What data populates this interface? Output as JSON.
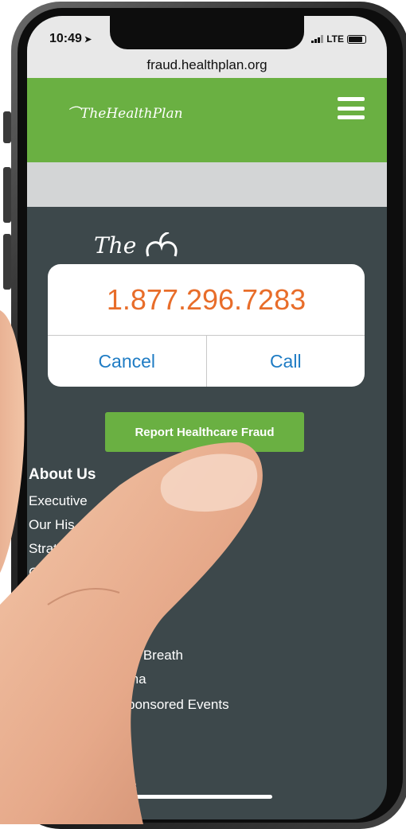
{
  "status": {
    "time": "10:49",
    "network": "LTE",
    "battery_level": 0.85
  },
  "browser": {
    "url": "fraud.healthplan.org"
  },
  "header": {
    "logo_text": "TheHealthPlan"
  },
  "page": {
    "big_logo_text": "The"
  },
  "dialog": {
    "phone_number": "1.877.296.7283",
    "cancel_label": "Cancel",
    "call_label": "Call"
  },
  "report_button": {
    "label": "Report Healthcare Fraud"
  },
  "footer": {
    "heading": "About Us",
    "links": [
      "Executive",
      "Our His",
      "Strat",
      "Ca",
      "ur Breath",
      "ma",
      "ponsored Events",
      "ases"
    ]
  },
  "colors": {
    "brand_green": "#6ab042",
    "page_dark": "#3d484b",
    "number_orange": "#e86d2a",
    "link_blue": "#1f7cc4"
  }
}
